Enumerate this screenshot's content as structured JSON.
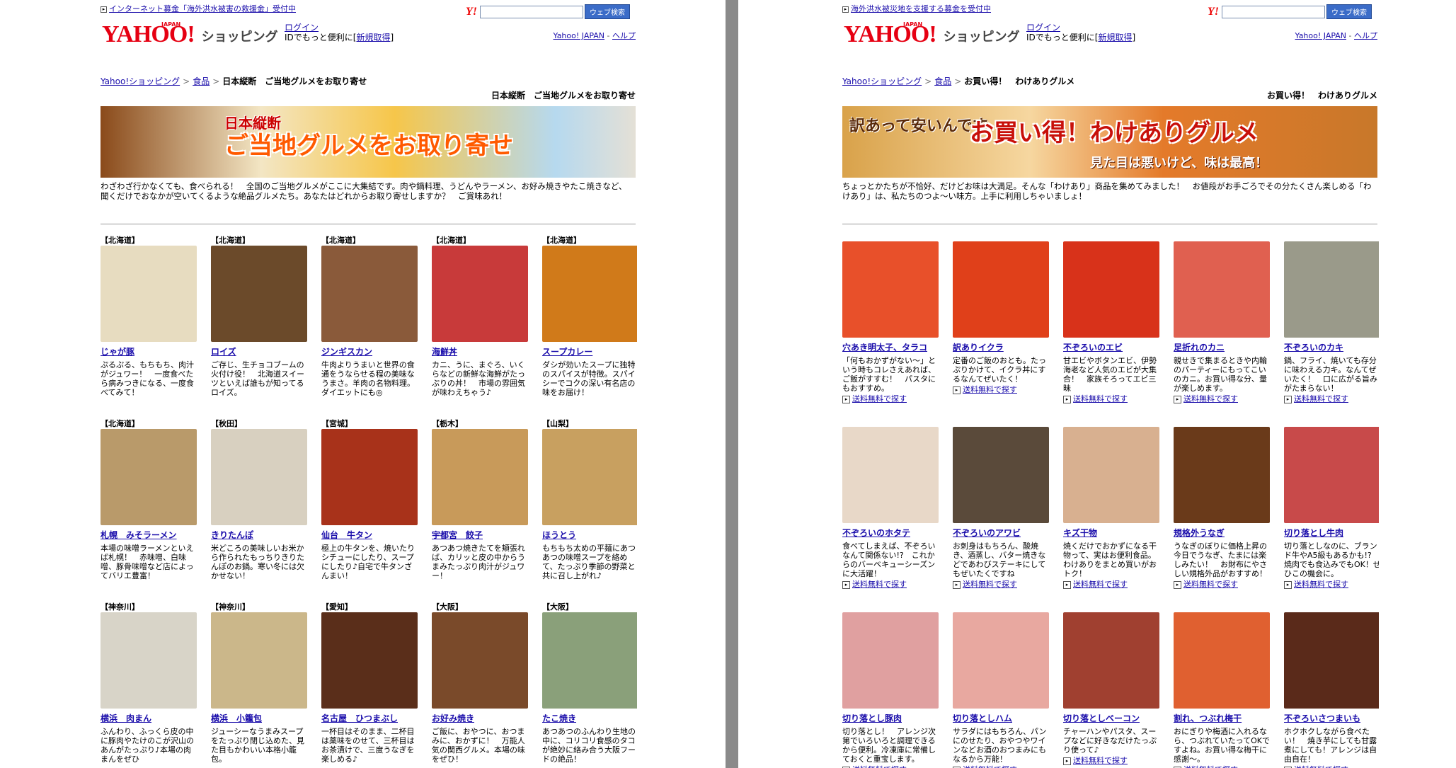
{
  "divider": "",
  "left": {
    "news": "インターネット募金「海外洪水被害の救援金」受付中",
    "search_btn": "ウェブ検索",
    "brand": {
      "logo": "YAHOO!",
      "japan": "JAPAN",
      "shop": "ショッピング"
    },
    "login": {
      "link": "ログイン",
      "text": "IDでもっと便利に[",
      "signup": "新規取得",
      "close": "]"
    },
    "header_links": {
      "yj": "Yahoo! JAPAN",
      "dash": " - ",
      "help": "ヘルプ"
    },
    "breadcrumb": [
      "Yahoo!ショッピング",
      "食品",
      "日本縦断　ご当地グルメをお取り寄せ"
    ],
    "page_title": "日本縦断　ご当地グルメをお取り寄せ",
    "banner": {
      "line1": "日本縦断",
      "line2": "ご当地グルメをお取り寄せ"
    },
    "description": "わざわざ行かなくても、食べられる！　全国のご当地グルメがここに大集結です。肉や鍋料理、うどんやラーメン、お好み焼きやたこ焼きなど、聞くだけでおなかが空いてくるような絶品グルメたち。あなたはどれからお取り寄せしますか？　ご賞味あれ！",
    "items": [
      {
        "pref": "【北海道】",
        "name": "じゃが豚",
        "text": "ぷるぷる、もちもち、肉汁がジュワー！　一度食べたら病みつきになる、一度食べてみて！",
        "color": "#e7dcc0"
      },
      {
        "pref": "【北海道】",
        "name": "ロイズ",
        "text": "ご存じ、生チョコブームの火付け役！　北海道スイーツといえば誰もが知ってるロイズ。",
        "color": "#6b4a2a"
      },
      {
        "pref": "【北海道】",
        "name": "ジンギスカン",
        "text": "牛肉よりうまいと世界の食通をうならせる程の美味なうまさ。羊肉の名物料理。ダイエットにも◎",
        "color": "#8a5a3a"
      },
      {
        "pref": "【北海道】",
        "name": "海鮮丼",
        "text": "カニ、うに、まぐろ、いくらなどの新鮮な海鮮がたっぷりの丼！　市場の雰囲気が味わえちゃう♪",
        "color": "#c83a3a"
      },
      {
        "pref": "【北海道】",
        "name": "スープカレー",
        "text": "ダシが効いたスープに独特のスパイスが特徴。スパイシーでコクの深い有名店の味をお届け！",
        "color": "#d07a1a"
      },
      {
        "pref": "【北海道】",
        "name": "札幌　みそラーメン",
        "text": "本場の味噌ラーメンといえば札幌！　赤味噌、白味噌、豚骨味噌など店によってバリエ豊富！",
        "color": "#b99a6a"
      },
      {
        "pref": "【秋田】",
        "name": "きりたんぽ",
        "text": "米どころの美味しいお米から作られたもっちりきりたんぽのお鍋。寒い冬には欠かせない！",
        "color": "#d8d0c0"
      },
      {
        "pref": "【宮城】",
        "name": "仙台　牛タン",
        "text": "極上の牛タンを、焼いたりシチューにしたり、スープにしたり♪自宅で牛タンざんまい！",
        "color": "#a8321a"
      },
      {
        "pref": "【栃木】",
        "name": "宇都宮　餃子",
        "text": "あつあつ焼きたてを頬張れば、カリッと皮の中からうまみたっぷり肉汁がジュワー！",
        "color": "#c89a5a"
      },
      {
        "pref": "【山梨】",
        "name": "ほうとう",
        "text": "もちもち太めの平麺にあつあつの味噌スープを絡めて、たっぷり季節の野菜と共に召し上がれ♪",
        "color": "#c8a060"
      },
      {
        "pref": "【神奈川】",
        "name": "横浜　肉まん",
        "text": "ふんわり、ふっくら皮の中に豚肉やたけのこが沢山のあんがたっぷり♪本場の肉まんをぜひ",
        "color": "#d8d4c8"
      },
      {
        "pref": "【神奈川】",
        "name": "横浜　小籠包",
        "text": "ジューシーなうまみスープをたっぷり閉じ込めた、見た目もかわいい本格小籠包。",
        "color": "#cbb78a"
      },
      {
        "pref": "【愛知】",
        "name": "名古屋　ひつまぶし",
        "text": "一杯目はそのまま、二杯目は薬味をのせて、三杯目はお茶漬けで、三度うなぎを楽しめる♪",
        "color": "#5a2e1a"
      },
      {
        "pref": "【大阪】",
        "name": "お好み焼き",
        "text": "ご飯に、おやつに、おつまみに、おかずに！　万能人気の関西グルメ。本場の味をぜひ！",
        "color": "#7a4a2a"
      },
      {
        "pref": "【大阪】",
        "name": "たこ焼き",
        "text": "あつあつのふんわり生地の中に、コリコリ食感のタコが絶妙に絡み合う大阪フードの絶品！",
        "color": "#8aa07a"
      }
    ]
  },
  "right": {
    "news": "海外洪水被災地を支援する募金を受付中",
    "search_btn": "ウェブ検索",
    "brand": {
      "logo": "YAHOO!",
      "japan": "JAPAN",
      "shop": "ショッピング"
    },
    "login": {
      "link": "ログイン",
      "text": "IDでもっと便利に[",
      "signup": "新規取得",
      "close": "]"
    },
    "header_links": {
      "yj": "Yahoo! JAPAN",
      "dash": " - ",
      "help": "ヘルプ"
    },
    "breadcrumb": [
      "Yahoo!ショッピング",
      "食品",
      "お買い得！　わけありグルメ"
    ],
    "page_title": "お買い得！　わけありグルメ",
    "banner": {
      "line1": "訳あって安いんです",
      "line2": "お買い得！わけありグルメ",
      "line3": "見た目は悪いけど、味は最高！"
    },
    "description": "ちょっとかたちが不恰好、だけどお味は大満足。そんな「わけあり」商品を集めてみました！　お値段がお手ごろでその分たくさん楽しめる「わけあり」は、私たちのつよ〜い味方。上手に利用しちゃいましょ！",
    "free_label": "送料無料で探す",
    "items": [
      {
        "name": "穴あき明太子、タラコ",
        "text": "「何もおかずがない〜」という時もコレさえあれば、ご飯がすすむ！　パスタにもおすすめ。",
        "color": "#e8502a"
      },
      {
        "name": "訳ありイクラ",
        "text": "定番のご飯のおとも。たっぷりかけて、イクラ丼にするなんてぜいたく！",
        "color": "#e0401a"
      },
      {
        "name": "不ぞろいのエビ",
        "text": "甘エビやボタンエビ、伊勢海老など人気のエビが大集合！　家族そろってエビ三昧",
        "color": "#d8321a"
      },
      {
        "name": "足折れのカニ",
        "text": "親せきで集まるときや内輪のパーティーにもってこいのカニ。お買い得な分、量が楽しめます。",
        "color": "#e06050"
      },
      {
        "name": "不ぞろいのカキ",
        "text": "鍋、フライ、焼いても存分に味わえる力キ。なんてぜいたく！　口に広がる旨みがたまらない！",
        "color": "#9a9a8a"
      },
      {
        "name": "不ぞろいのホタテ",
        "text": "食べてしまえば、不ぞろいなんて関係ない!?　これからのバーベキューシーズンに大活躍！",
        "color": "#e8d8c8"
      },
      {
        "name": "不ぞろいのアワビ",
        "text": "お刺身はもちろん、酸焼き、酒蒸し、バター焼きなどであわびステーキにしてもぜいたくですね",
        "color": "#5a4a3a"
      },
      {
        "name": "キズ干物",
        "text": "焼くだけでおかずになる干物って、実はお便利食品。わけありをまとめ買いがおトク！",
        "color": "#d8b090"
      },
      {
        "name": "規格外うなぎ",
        "text": "うなぎのぼりに価格上昇の今日でうなぎ、たまには楽しみたい！　お財布にやさしい規格外品がおすすめ！",
        "color": "#6a3a1a"
      },
      {
        "name": "切り落とし牛肉",
        "text": "切り落としなのに、ブランド牛やA5級もあるかも!?　焼肉でも食込みでもOK！ぜひこの機会に。",
        "color": "#c84a4a"
      },
      {
        "name": "切り落とし豚肉",
        "text": "切り落とし！　アレンジ次第でいろいろと調理できるから便利。冷凍庫に常備しておくと重宝します。",
        "color": "#e0a0a0"
      },
      {
        "name": "切り落としハム",
        "text": "サラダにはもちろん、パンにのせたり、おやつやワインなどお酒のおつまみにもなるから万能！",
        "color": "#e8a8a0"
      },
      {
        "name": "切り落としベーコン",
        "text": "チャーハンやパスタ、スープなどに好きなだけたっぷり使って♪",
        "color": "#a04030"
      },
      {
        "name": "割れ、つぶれ梅干",
        "text": "おにぎりや梅酒に入れるなら、つぶれていたってOKですよね。お買い得な梅干に感謝〜。",
        "color": "#e06030"
      },
      {
        "name": "不ぞろいさつまいも",
        "text": "ホクホクしながら食べたい！　焼き芋にしても甘露煮にしても！アレンジは自由自在！",
        "color": "#5a2a1a"
      }
    ]
  }
}
